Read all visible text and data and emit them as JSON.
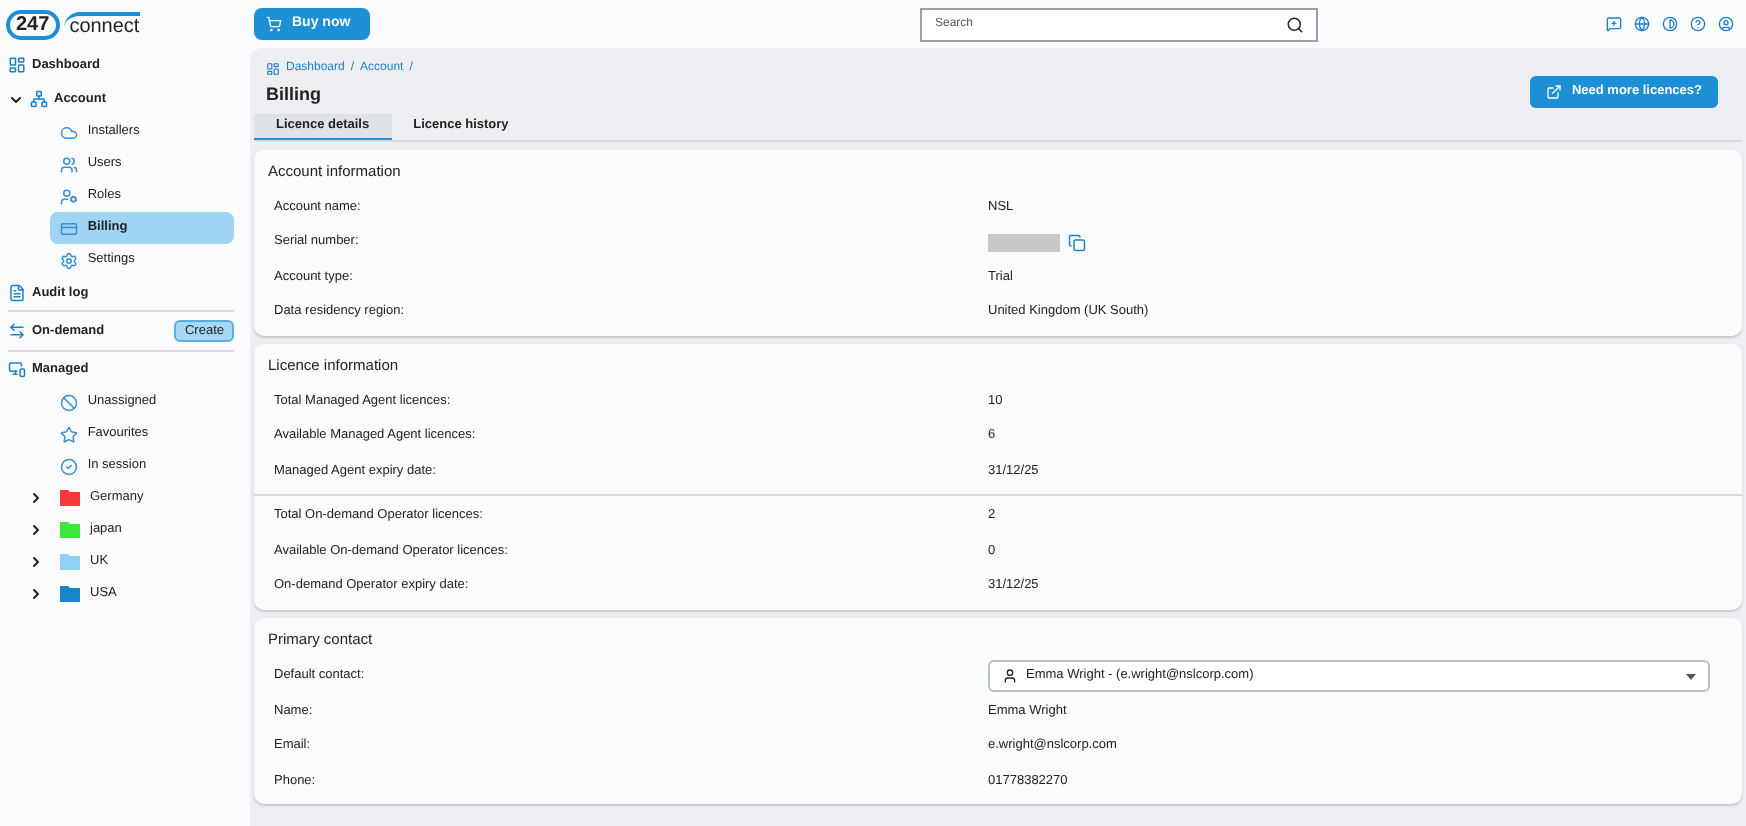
{
  "logo": {
    "number": "247",
    "word": "connect"
  },
  "topbar": {
    "buy_button": "Buy now",
    "search": {
      "placeholder": "Search"
    }
  },
  "sidebar": {
    "items": [
      {
        "label": "Dashboard"
      },
      {
        "label": "Account",
        "expanded": true,
        "children": [
          {
            "label": "Installers",
            "selected": false
          },
          {
            "label": "Users",
            "selected": false
          },
          {
            "label": "Roles",
            "selected": false
          },
          {
            "label": "Billing",
            "selected": true
          },
          {
            "label": "Settings",
            "selected": false
          }
        ]
      },
      {
        "label": "Audit log"
      },
      {
        "label": "On-demand",
        "action": "Create"
      },
      {
        "label": "Managed",
        "children": [
          {
            "label": "Unassigned",
            "selected": false
          },
          {
            "label": "Favourites",
            "selected": false
          },
          {
            "label": "In session",
            "selected": false
          },
          {
            "label": "Germany",
            "selected": false,
            "expanded": false,
            "color": "#f23b3b"
          },
          {
            "label": "japan",
            "selected": false,
            "expanded": false,
            "color": "#3de83d"
          },
          {
            "label": "UK",
            "selected": false,
            "expanded": false,
            "color": "#8fd0f5"
          },
          {
            "label": "USA",
            "selected": false,
            "expanded": false,
            "color": "#1686c9"
          }
        ]
      }
    ]
  },
  "page": {
    "breadcrumb": [
      "Dashboard",
      "Account"
    ],
    "breadcrumb_separator": "/",
    "title": "Billing",
    "action_button": "Need more licences?",
    "tabs": [
      {
        "label": "Licence details",
        "selected": true
      },
      {
        "label": "Licence history",
        "selected": false
      }
    ]
  },
  "sections": [
    {
      "title": "Account information",
      "groups": [
        [
          {
            "label": "Account name:",
            "value": "NSL"
          },
          {
            "label": "Serial number:",
            "kind": "redacted"
          },
          {
            "label": "Account type:",
            "value": "Trial"
          },
          {
            "label": "Data residency region:",
            "value": "United Kingdom (UK South)"
          }
        ]
      ]
    },
    {
      "title": "Licence information",
      "groups": [
        [
          {
            "label": "Total Managed Agent licences:",
            "value": "10"
          },
          {
            "label": "Available Managed Agent licences:",
            "value": "6"
          },
          {
            "label": "Managed Agent expiry date:",
            "value": "31/12/25"
          }
        ],
        [
          {
            "label": "Total On-demand Operator licences:",
            "value": "2"
          },
          {
            "label": "Available On-demand Operator licences:",
            "value": "0"
          },
          {
            "label": "On-demand Operator expiry date:",
            "value": "31/12/25"
          }
        ]
      ]
    },
    {
      "title": "Primary contact",
      "groups": [
        [
          {
            "label": "Default contact:",
            "kind": "select",
            "value": "Emma Wright - (e.wright@nslcorp.com)"
          },
          {
            "label": "Name:",
            "value": "Emma Wright"
          },
          {
            "label": "Email:",
            "value": "e.wright@nslcorp.com"
          },
          {
            "label": "Phone:",
            "value": "01778382270"
          }
        ]
      ]
    }
  ]
}
